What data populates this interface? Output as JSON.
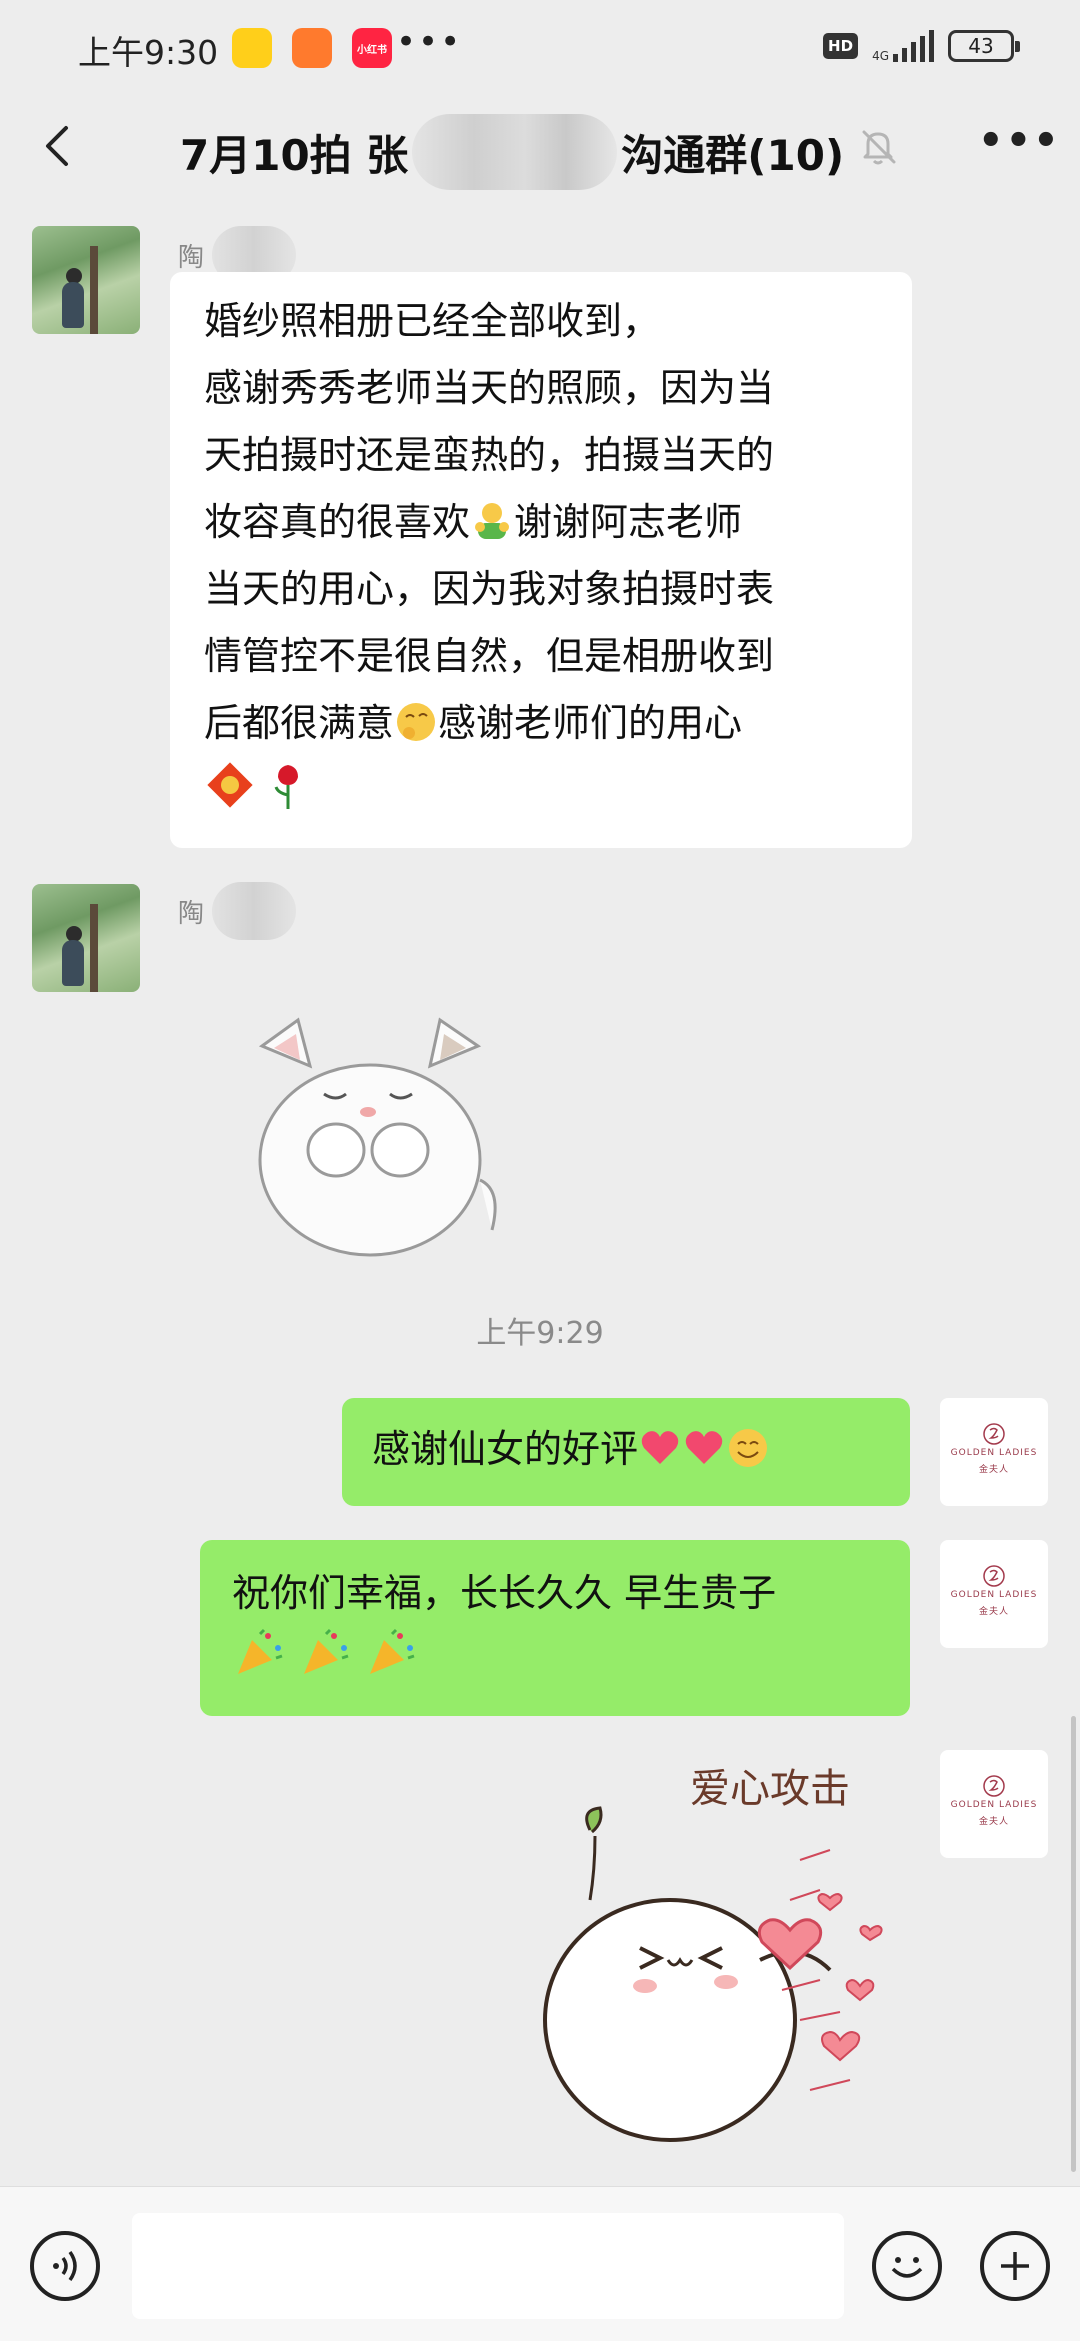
{
  "status_bar": {
    "time": "上午9:30",
    "apps": [
      "小红书"
    ],
    "hd": "HD",
    "network": "4G",
    "battery": "43"
  },
  "header": {
    "title_prefix": "7月10拍 张",
    "title_suffix": "沟通群(10)",
    "back_icon": "chevron-left-icon",
    "mute_icon": "bell-off-icon",
    "more_icon": "more-icon"
  },
  "messages": [
    {
      "sender": "陶",
      "lines": [
        "婚纱照相册已经全部收到，",
        "感谢秀秀老师当天的照顾，因为当",
        "天拍摄时还是蛮热的，拍摄当天的",
        "妆容真的很喜欢",
        "谢谢阿志老师",
        "当天的用心，因为我对象拍摄时表",
        "情管控不是很自然，但是相册收到",
        "后都很满意",
        "感谢老师们的用心"
      ]
    },
    {
      "sender": "陶",
      "sticker": "cat-sticker"
    }
  ],
  "timestamp": "上午9:29",
  "outgoing": [
    {
      "text": "感谢仙女的好评"
    },
    {
      "text": "祝你们幸福，长长久久 早生贵子"
    },
    {
      "sticker_text": "爱心攻击"
    }
  ],
  "brand_avatar": {
    "name": "GOLDEN LADIES",
    "cn": "金夫人"
  },
  "colors": {
    "background": "#ededed",
    "outgoing_bubble": "#95ec69",
    "incoming_bubble": "#ffffff"
  }
}
